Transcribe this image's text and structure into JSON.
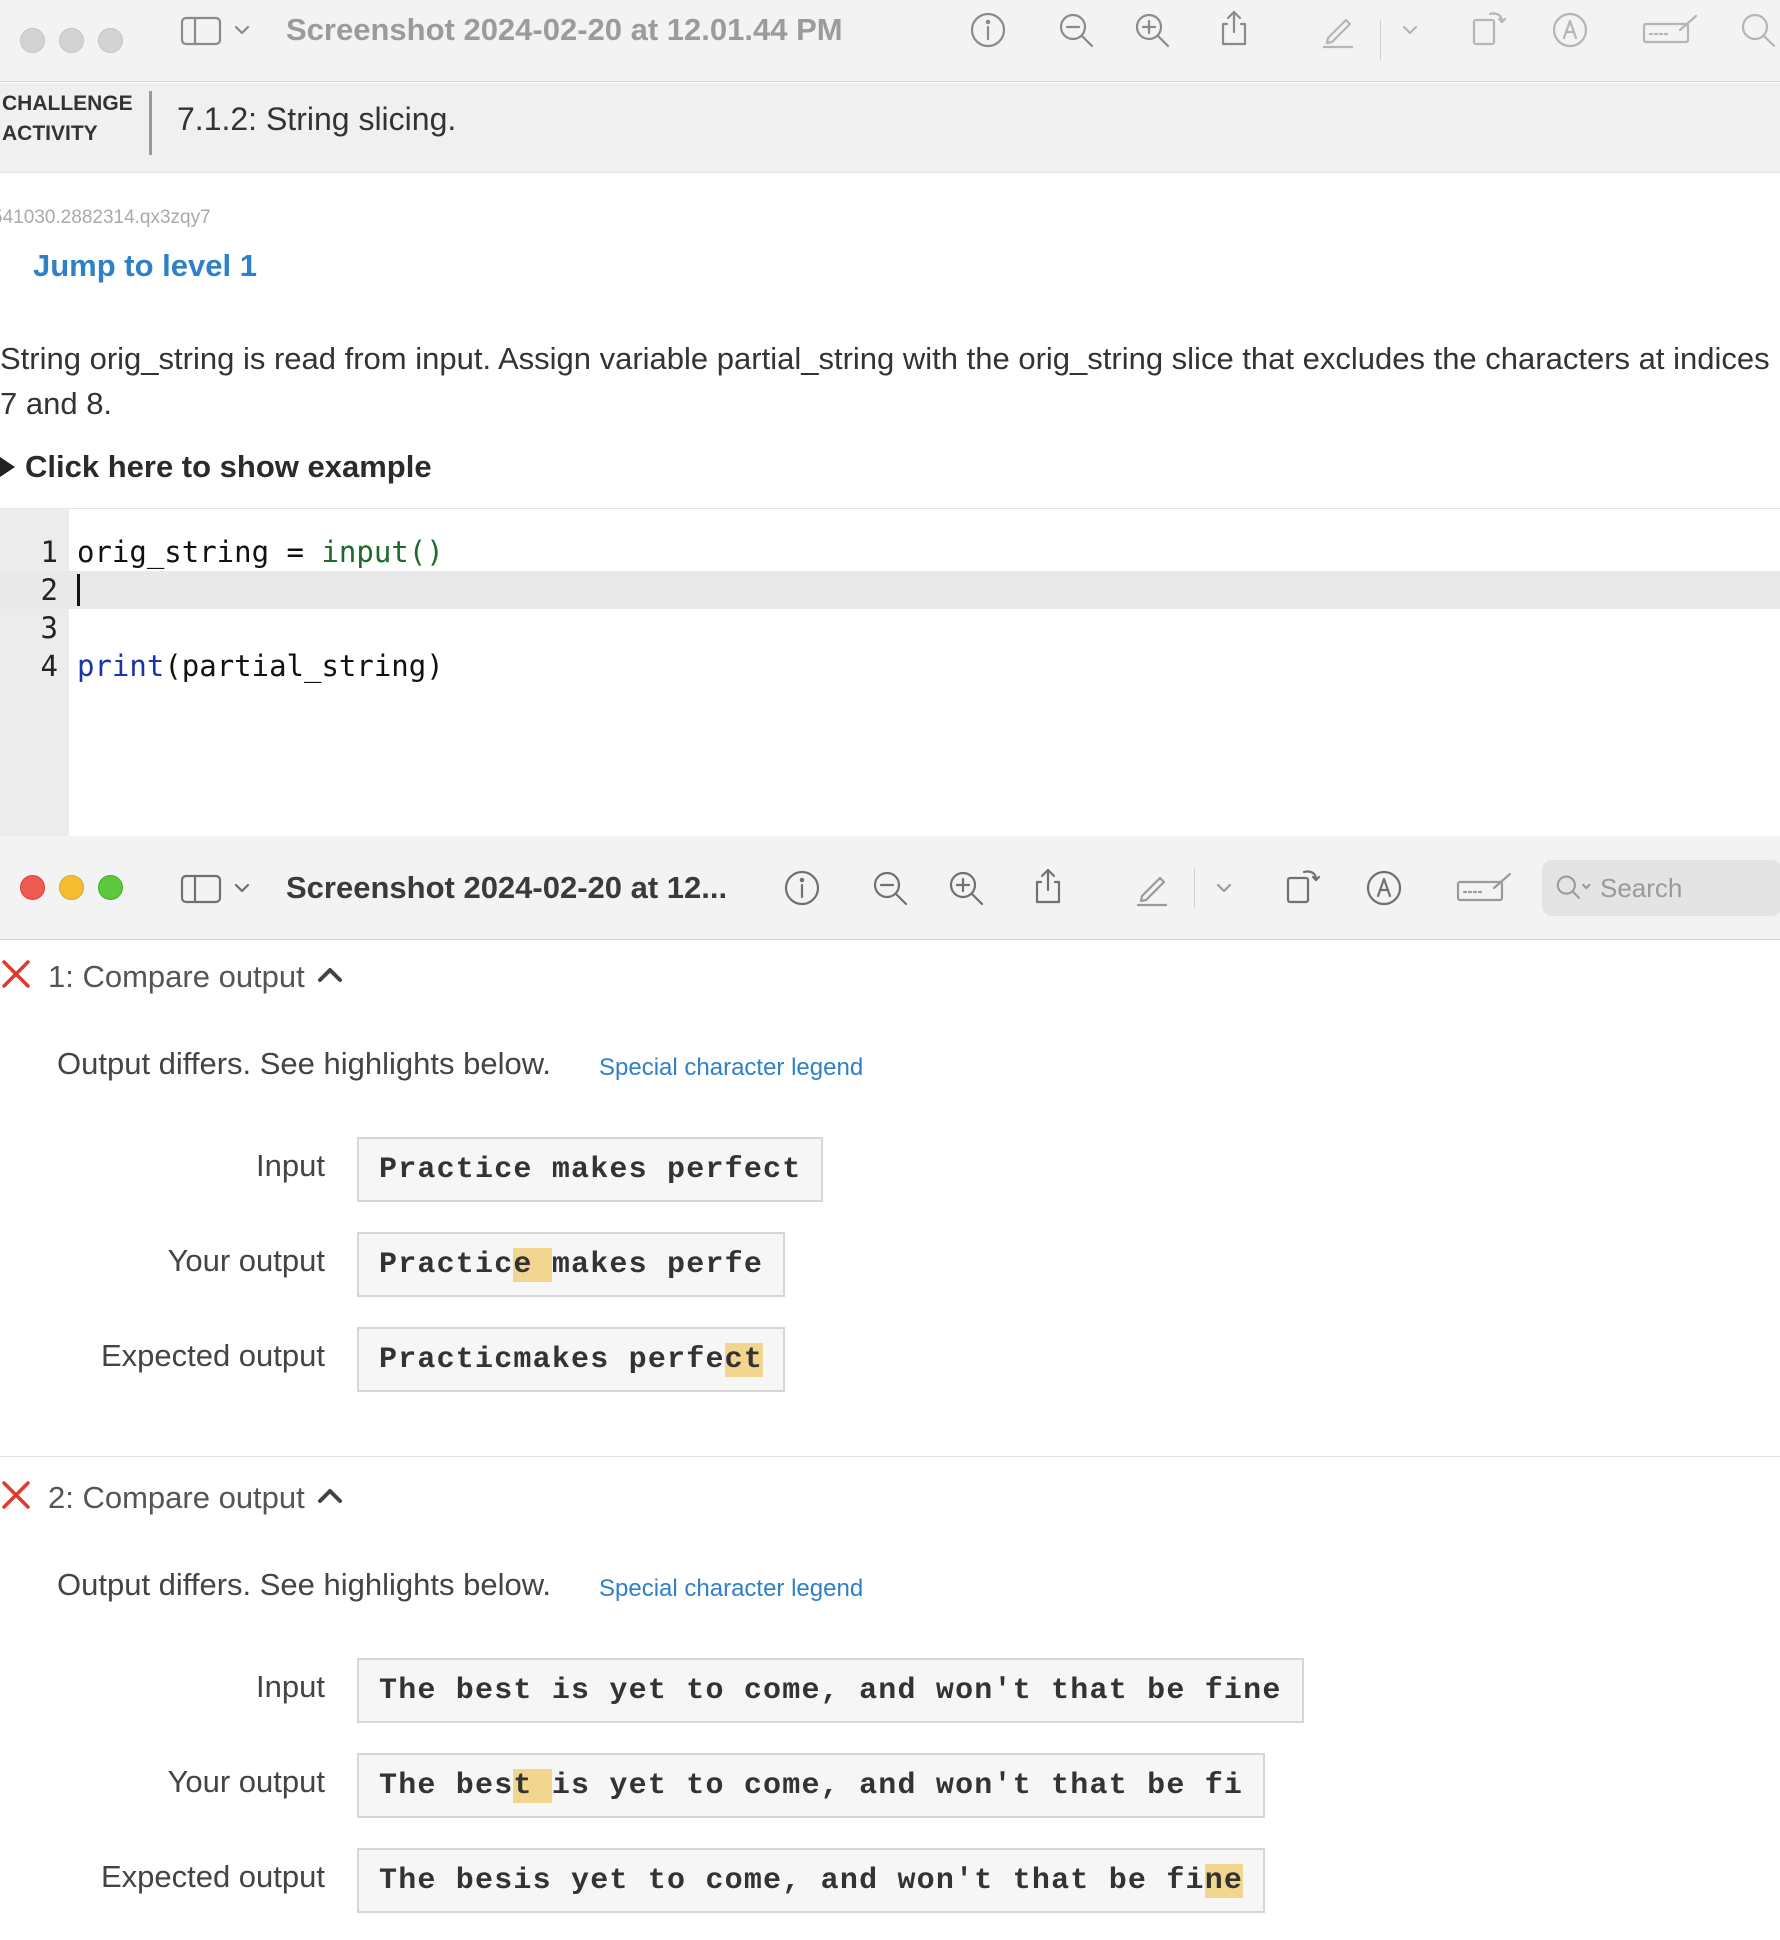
{
  "top_window": {
    "title": "Screenshot 2024-02-20 at 12.01.44 PM"
  },
  "challenge": {
    "tag_line1": "CHALLENGE",
    "tag_line2": "ACTIVITY",
    "title": "7.1.2: String slicing.",
    "activity_id": "541030.2882314.qx3zqy7",
    "jump_link": "Jump to level 1",
    "prompt": "String orig_string is read from input. Assign variable partial_string with the orig_string slice that excludes the characters at indices 7 and 8.",
    "show_example": "Click here to show example"
  },
  "editor": {
    "lines": [
      {
        "num": "1",
        "var": "orig_string",
        "op": " = ",
        "fn": "input()"
      },
      {
        "num": "2"
      },
      {
        "num": "3"
      },
      {
        "num": "4",
        "kw": "print",
        "args": "(partial_string)"
      }
    ]
  },
  "bottom_window": {
    "title": "Screenshot 2024-02-20 at 12...",
    "search_placeholder": "Search"
  },
  "tests": [
    {
      "title": "1: Compare output",
      "message": "Output differs. See highlights below.",
      "legend": "Special character legend",
      "input_label": "Input",
      "input": "Practice makes perfect",
      "your_label": "Your output",
      "your_output_parts": [
        "Practic",
        "e ",
        "makes perfe"
      ],
      "expected_label": "Expected output",
      "expected_parts": [
        "Practicmakes perfe",
        "ct",
        ""
      ]
    },
    {
      "title": "2: Compare output",
      "message": "Output differs. See highlights below.",
      "legend": "Special character legend",
      "input_label": "Input",
      "input": "The best is yet to come, and won't that be fine",
      "your_label": "Your output",
      "your_output_parts": [
        "The bes",
        "t ",
        "is yet to come, and won't that be fi"
      ],
      "expected_label": "Expected output",
      "expected_parts": [
        "The besis yet to come, and won't that be fi",
        "ne",
        ""
      ]
    }
  ],
  "colors": {
    "link": "#2f80c8",
    "highlight": "#f2d58e",
    "fail_x": "#e0392e"
  }
}
